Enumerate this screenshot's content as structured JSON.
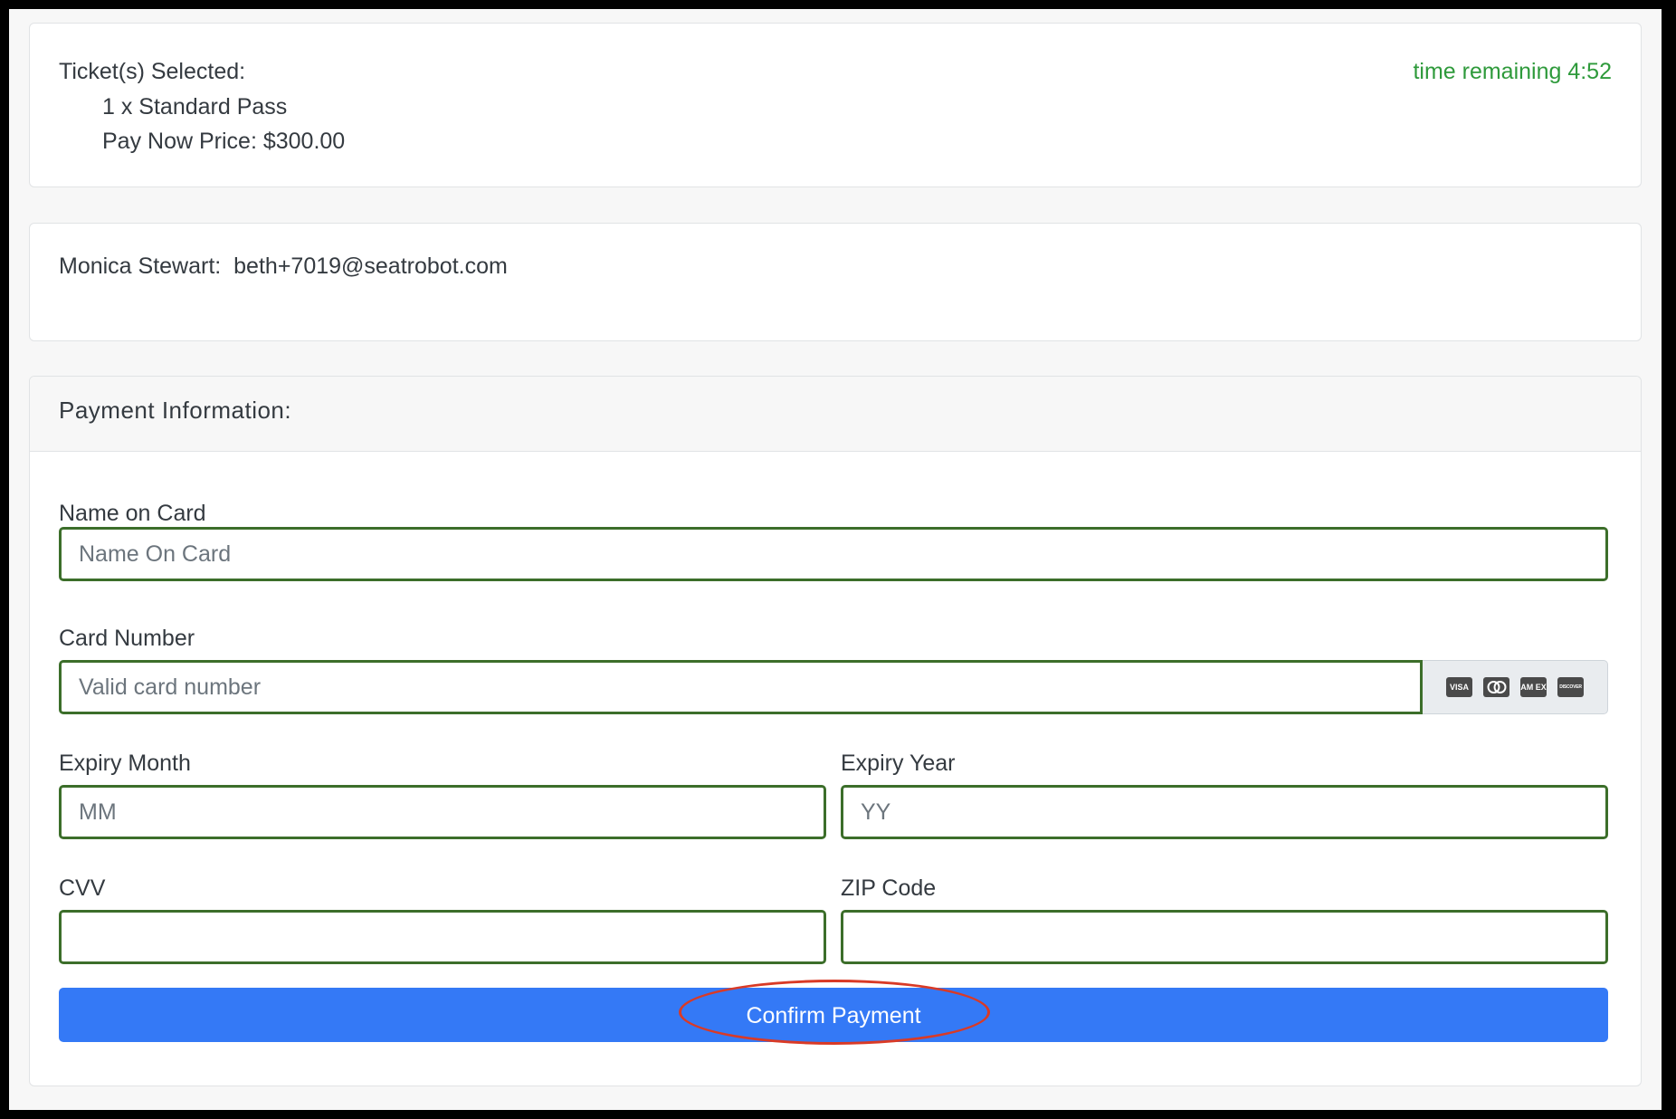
{
  "ticket_summary": {
    "heading": "Ticket(s) Selected:",
    "ticket_line": "1 x Standard Pass",
    "price_line": "Pay Now Price: $300.00",
    "timer": "time remaining 4:52"
  },
  "contact": {
    "name": "Monica Stewart:",
    "email": "beth+7019@seatrobot.com"
  },
  "payment": {
    "header": "Payment Information:",
    "name_on_card": {
      "label": "Name on Card",
      "placeholder": "Name On Card",
      "value": ""
    },
    "card_number": {
      "label": "Card Number",
      "placeholder": "Valid card number",
      "value": "",
      "accepted_cards": [
        "visa-icon",
        "mastercard-icon",
        "amex-icon",
        "discover-icon"
      ],
      "card_logo_text": {
        "visa": "VISA",
        "amex": "AM EX",
        "discover": "DISCOVER"
      }
    },
    "expiry_month": {
      "label": "Expiry Month",
      "placeholder": "MM",
      "value": ""
    },
    "expiry_year": {
      "label": "Expiry Year",
      "placeholder": "YY",
      "value": ""
    },
    "cvv": {
      "label": "CVV",
      "placeholder": "",
      "value": ""
    },
    "zip": {
      "label": "ZIP Code",
      "placeholder": "",
      "value": ""
    },
    "confirm_label": "Confirm Payment"
  },
  "colors": {
    "timer": "#2e9a3b",
    "input_border": "#3c6e2a",
    "button": "#3479f6",
    "annotation": "#d93a26"
  }
}
